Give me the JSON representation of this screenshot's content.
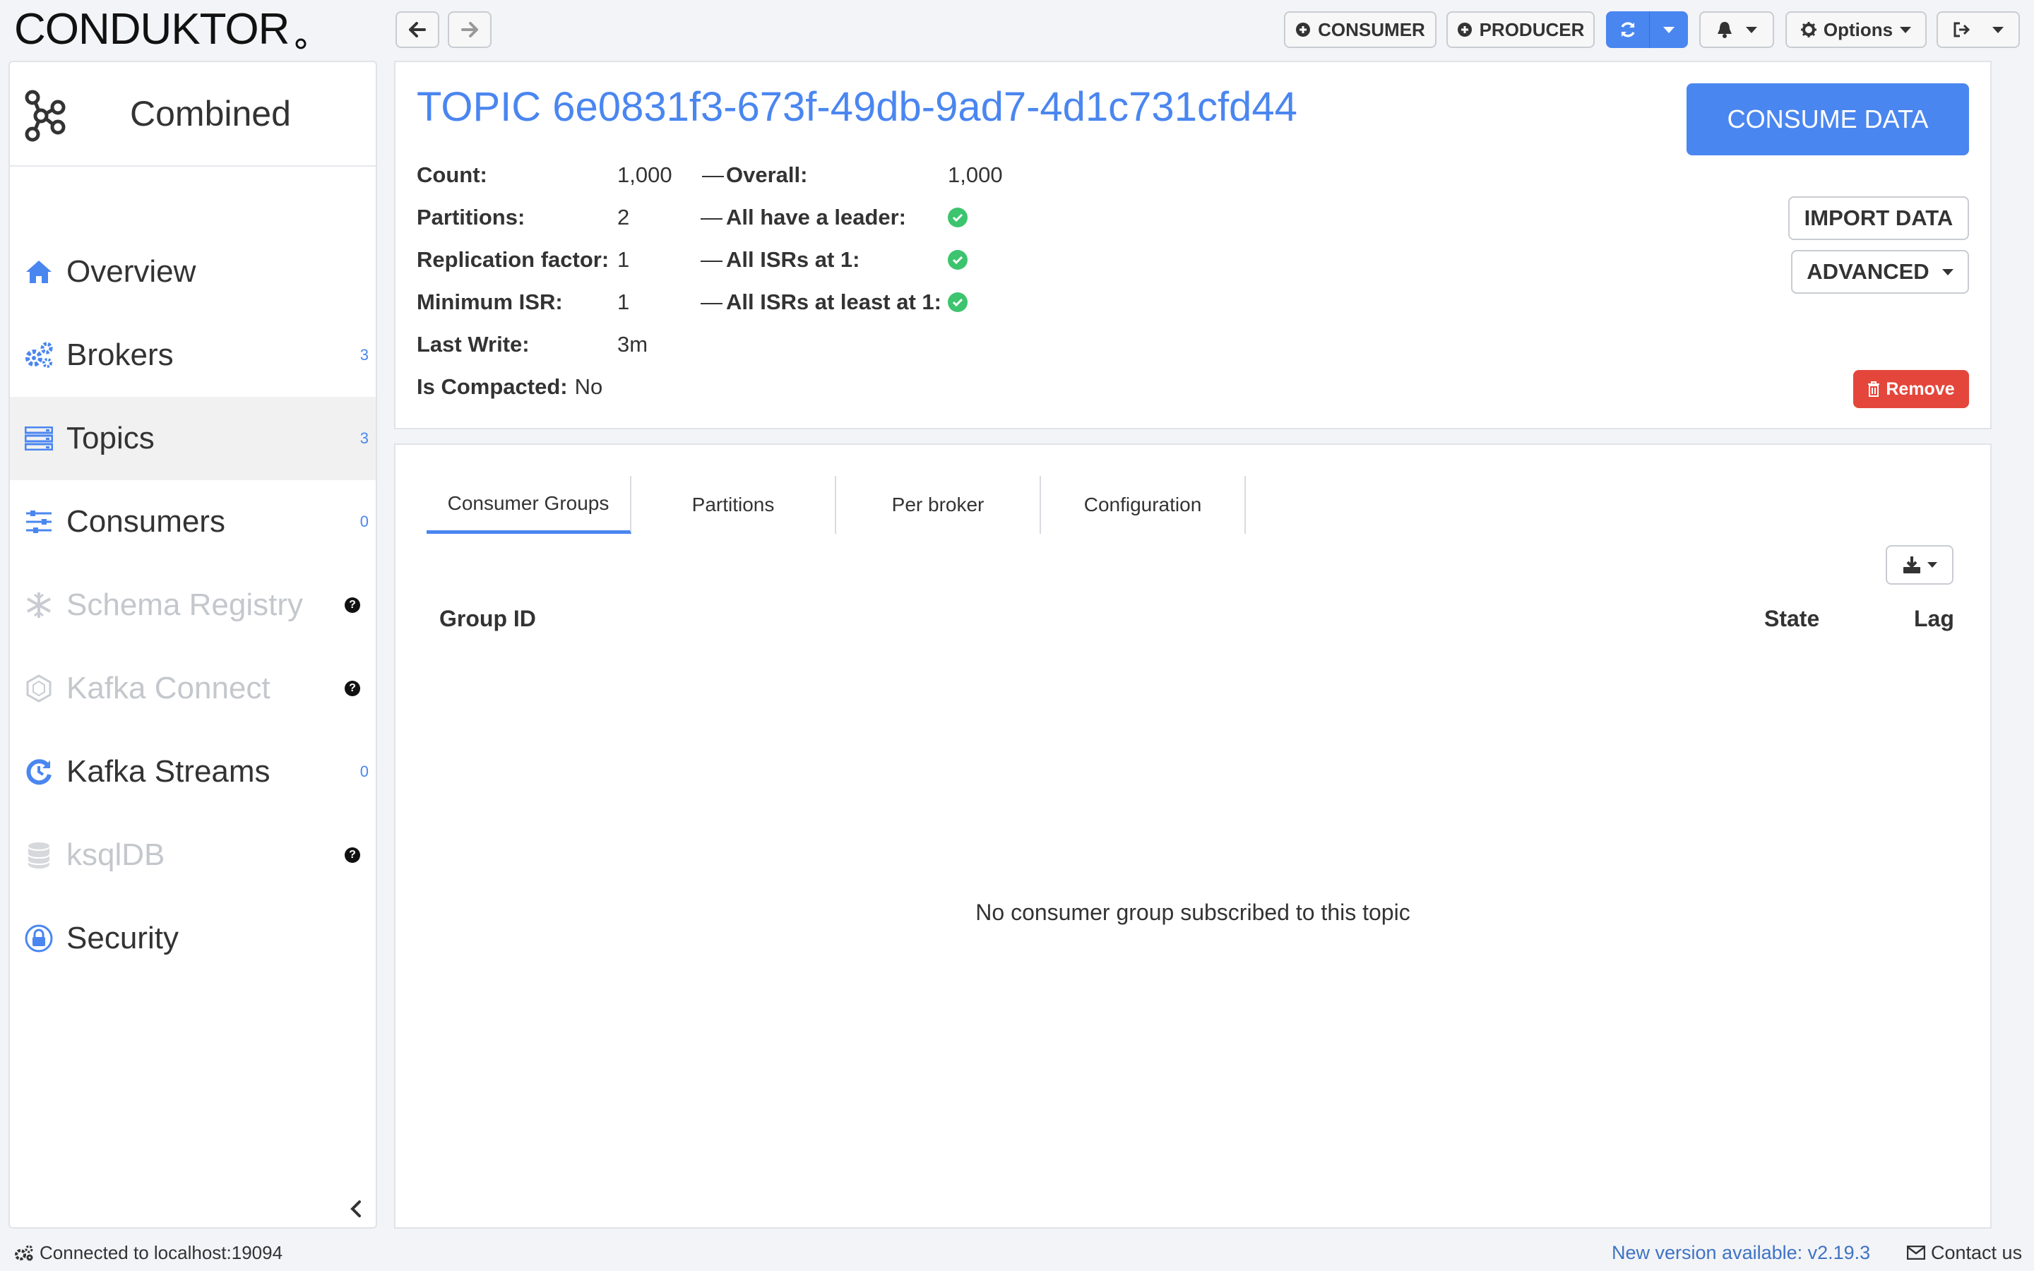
{
  "app": {
    "logo_text": "CONDUKTOR",
    "colors": {
      "accent": "#4a86f0",
      "danger": "#e4463b",
      "success": "#3cc46e"
    }
  },
  "toolbar": {
    "back_icon": "arrow-left-icon",
    "forward_icon": "arrow-right-icon",
    "consumer_label": "CONSUMER",
    "producer_label": "PRODUCER",
    "options_label": "Options"
  },
  "sidebar": {
    "cluster_name": "Combined",
    "items": [
      {
        "label": "Overview",
        "icon": "home-icon",
        "count": ""
      },
      {
        "label": "Brokers",
        "icon": "cogs-icon",
        "count": "3"
      },
      {
        "label": "Topics",
        "icon": "server-list-icon",
        "count": "3"
      },
      {
        "label": "Consumers",
        "icon": "sliders-icon",
        "count": "0"
      },
      {
        "label": "Schema Registry",
        "icon": "snowflake-icon",
        "help": "?"
      },
      {
        "label": "Kafka Connect",
        "icon": "hexagon-icon",
        "help": "?"
      },
      {
        "label": "Kafka Streams",
        "icon": "stream-icon",
        "count": "0"
      },
      {
        "label": "ksqlDB",
        "icon": "database-icon",
        "help": "?"
      },
      {
        "label": "Security",
        "icon": "lock-icon",
        "count": ""
      }
    ]
  },
  "topic": {
    "title": "TOPIC 6e0831f3-673f-49db-9ad7-4d1c731cfd44",
    "consume_label": "CONSUME DATA",
    "import_label": "IMPORT DATA",
    "advanced_label": "ADVANCED",
    "remove_label": "Remove",
    "dash": "—",
    "meta": {
      "count_label": "Count:",
      "count_value": "1,000",
      "overall_label": "Overall:",
      "overall_value": "1,000",
      "partitions_label": "Partitions:",
      "partitions_value": "2",
      "leader_label": "All have a leader:",
      "replication_label": "Replication factor:",
      "replication_value": "1",
      "isrs_label": "All ISRs at 1:",
      "min_isr_label": "Minimum ISR:",
      "min_isr_value": "1",
      "isrs_least_label": "All ISRs at least at 1:",
      "last_write_label": "Last Write:",
      "last_write_value": "3m",
      "compacted_label": "Is Compacted:",
      "compacted_value": "No"
    }
  },
  "tabs": {
    "items": [
      "Consumer Groups",
      "Partitions",
      "Per broker",
      "Configuration"
    ],
    "active": "Consumer Groups"
  },
  "table": {
    "columns": [
      "Group ID",
      "State",
      "Lag"
    ],
    "empty_message": "No consumer group subscribed to this topic"
  },
  "statusbar": {
    "connection": "Connected to localhost:19094",
    "new_version": "New version available: v2.19.3",
    "contact": "Contact us"
  }
}
